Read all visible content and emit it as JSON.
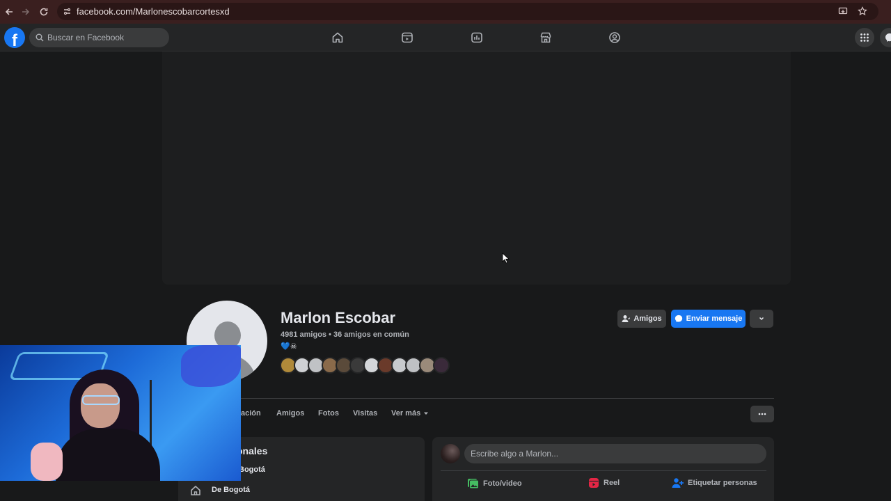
{
  "browser": {
    "url": "facebook.com/Marlonescobarcortesxd"
  },
  "header": {
    "logo_letter": "f",
    "search_placeholder": "Buscar en Facebook"
  },
  "profile": {
    "name": "Marlon Escobar",
    "friends_summary": "4981 amigos • 36 amigos en común",
    "bio_emoji": "💙☠",
    "buttons": {
      "friends": "Amigos",
      "message": "Enviar mensaje"
    }
  },
  "tabs": [
    {
      "label": "ación"
    },
    {
      "label": "Amigos"
    },
    {
      "label": "Fotos"
    },
    {
      "label": "Visitas"
    },
    {
      "label": "Ver más"
    }
  ],
  "info_card": {
    "title": "onales",
    "line1": "Bogotá",
    "line2": "De Bogotá"
  },
  "composer": {
    "placeholder": "Escribe algo a Marlon...",
    "actions": {
      "photo": "Foto/video",
      "reel": "Reel",
      "tag": "Etiquetar personas"
    }
  },
  "colors": {
    "accent": "#1877f2",
    "bg": "#18191a",
    "card": "#242526"
  }
}
